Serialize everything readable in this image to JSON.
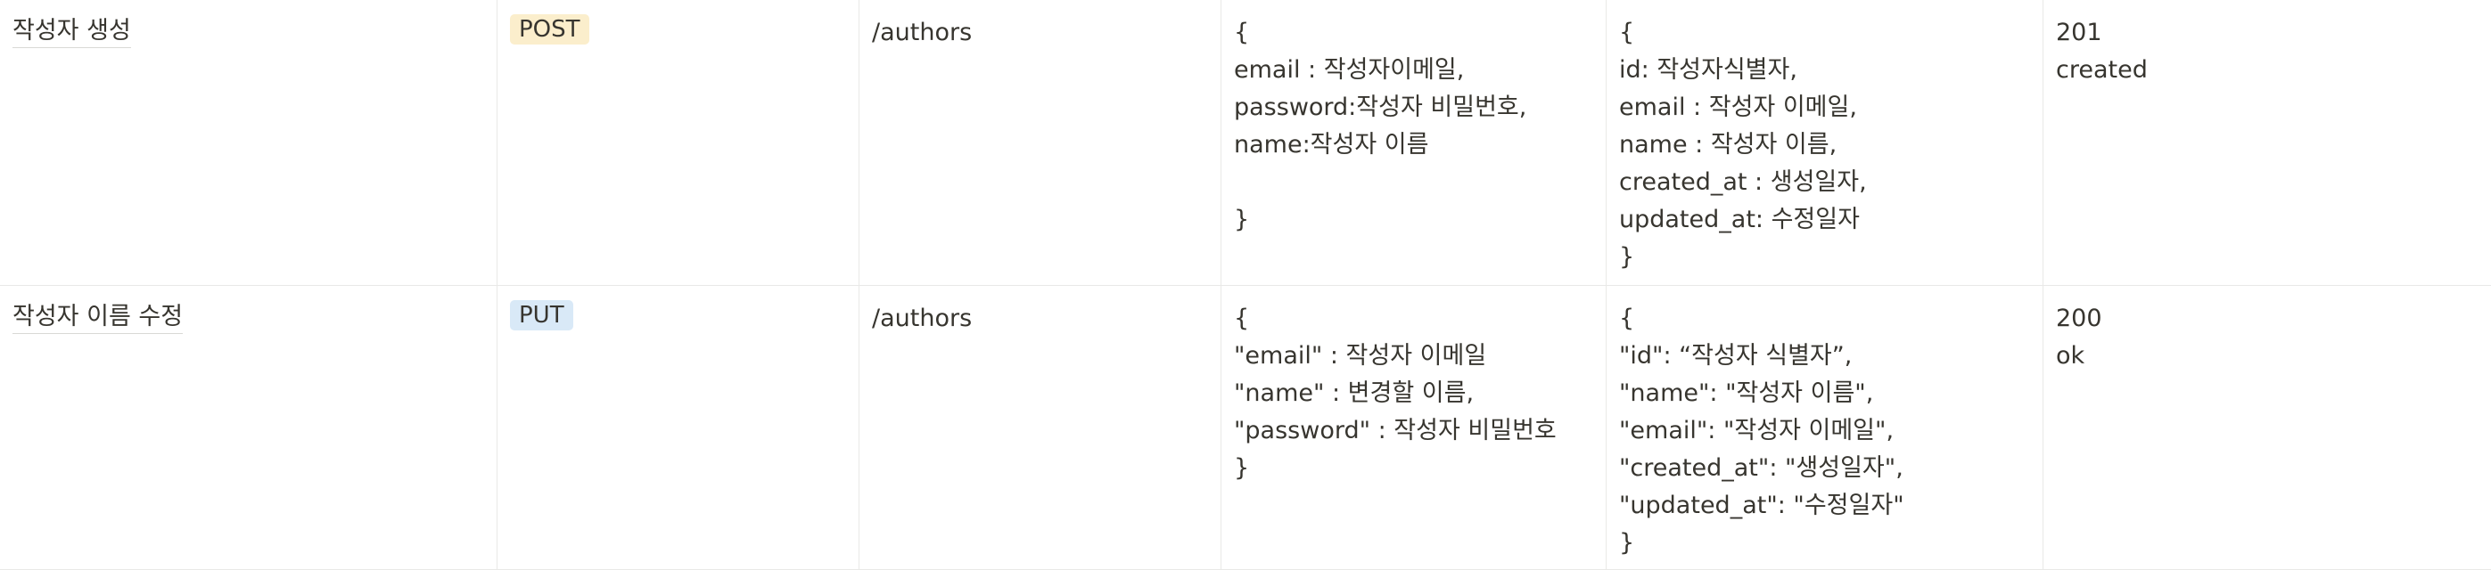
{
  "table": {
    "rows": [
      {
        "name": "작성자 생성",
        "method": "POST",
        "method_color": "#fbeecc",
        "path": "/authors",
        "request": [
          "{",
          "email : 작성자이메일,",
          "password:작성자 비밀번호,",
          "name:작성자 이름",
          "",
          "}"
        ],
        "response": [
          "{",
          "id: 작성자식별자,",
          "email : 작성자 이메일,",
          "name : 작성자 이름,",
          "created_at : 생성일자,",
          "updated_at: 수정일자",
          "}"
        ],
        "status": [
          "201",
          "created"
        ]
      },
      {
        "name": "작성자 이름 수정",
        "method": "PUT",
        "method_color": "#d9e9f7",
        "path": "/authors",
        "request": [
          "{",
          "\"email\" : 작성자 이메일",
          "\"name\" : 변경할 이름,",
          "\"password\" : 작성자 비밀번호",
          "}"
        ],
        "response": [
          "{",
          "\"id\": “작성자 식별자”,",
          "\"name\": \"작성자 이름\",",
          "\"email\": \"작성자 이메일\",",
          "\"created_at\": \"생성일자\",",
          "\"updated_at\": \"수정일자\"",
          "}"
        ],
        "status": [
          "200",
          "ok"
        ]
      }
    ]
  }
}
